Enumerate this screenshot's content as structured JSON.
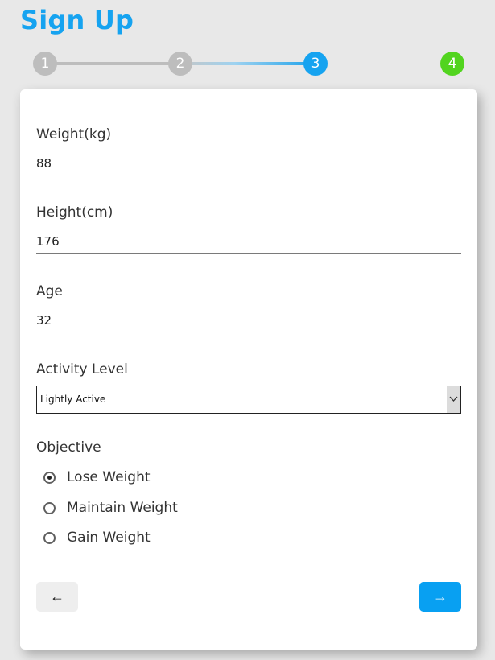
{
  "header": {
    "title": "Sign Up"
  },
  "stepper": {
    "steps": [
      "1",
      "2",
      "3",
      "4"
    ],
    "current_step": 3,
    "colors": {
      "inactive": "#bdbdbd",
      "active": "#16a3f0",
      "final": "#52d41f"
    }
  },
  "form": {
    "weight": {
      "label": "Weight(kg)",
      "value": "88"
    },
    "height": {
      "label": "Height(cm)",
      "value": "176"
    },
    "age": {
      "label": "Age",
      "value": "32"
    },
    "activity": {
      "label": "Activity Level",
      "selected": "Lightly Active"
    },
    "objective": {
      "label": "Objective",
      "options": [
        "Lose Weight",
        "Maintain Weight",
        "Gain Weight"
      ],
      "selected": "Lose Weight"
    }
  },
  "nav": {
    "back_icon": "arrow-left-icon",
    "back_glyph": "←",
    "next_icon": "arrow-right-icon",
    "next_glyph": "→",
    "next_color": "#08a0f2"
  }
}
